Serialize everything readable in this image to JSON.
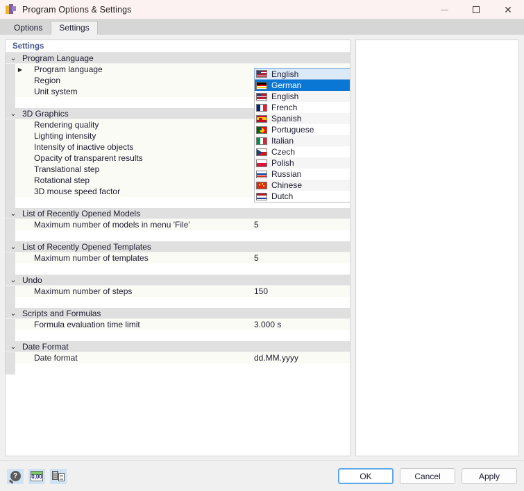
{
  "window": {
    "title": "Program Options & Settings",
    "icon": "app-logo-icon",
    "controls": {
      "minimize": "minimize-icon",
      "maximize": "maximize-icon",
      "close": "close-icon"
    }
  },
  "tabs": [
    {
      "label": "Options",
      "active": false
    },
    {
      "label": "Settings",
      "active": true
    }
  ],
  "grid": {
    "header": "Settings",
    "groups": [
      {
        "title": "Program Language",
        "expanded": true,
        "items": [
          {
            "label": "Program language",
            "value": "",
            "has_twisty": true
          },
          {
            "label": "Region",
            "value": ""
          },
          {
            "label": "Unit system",
            "value": ""
          }
        ]
      },
      {
        "title": "3D Graphics",
        "expanded": true,
        "items": [
          {
            "label": "Rendering quality",
            "value": ""
          },
          {
            "label": "Lighting intensity",
            "value": ""
          },
          {
            "label": "Intensity of inactive objects",
            "value": ""
          },
          {
            "label": "Opacity of transparent results",
            "value": ""
          },
          {
            "label": "Translational step",
            "value": ""
          },
          {
            "label": "Rotational step",
            "value": ""
          },
          {
            "label": "3D mouse speed factor",
            "value": ""
          }
        ]
      },
      {
        "title": "List of Recently Opened Models",
        "expanded": true,
        "items": [
          {
            "label": "Maximum number of models in menu 'File'",
            "value": "5"
          }
        ]
      },
      {
        "title": "List of Recently Opened Templates",
        "expanded": true,
        "items": [
          {
            "label": "Maximum number of templates",
            "value": "5"
          }
        ]
      },
      {
        "title": "Undo",
        "expanded": true,
        "items": [
          {
            "label": "Maximum number of steps",
            "value": "150"
          }
        ]
      },
      {
        "title": "Scripts and Formulas",
        "expanded": true,
        "items": [
          {
            "label": "Formula evaluation time limit",
            "value": "3.000 s"
          }
        ]
      },
      {
        "title": "Date Format",
        "expanded": true,
        "items": [
          {
            "label": "Date format",
            "value": "dd.MM.yyyy"
          }
        ]
      }
    ]
  },
  "language_combo": {
    "selected_display": "English",
    "selected_display_flag": "flag-us",
    "highlighted": "German",
    "chevron": "chevron-down-icon",
    "options": [
      {
        "label": "German",
        "flag": "flag-de",
        "selected": true
      },
      {
        "label": "English",
        "flag": "flag-us",
        "selected": false
      },
      {
        "label": "French",
        "flag": "flag-fr",
        "selected": false
      },
      {
        "label": "Spanish",
        "flag": "flag-es",
        "selected": false
      },
      {
        "label": "Portuguese",
        "flag": "flag-pt",
        "selected": false
      },
      {
        "label": "Italian",
        "flag": "flag-it",
        "selected": false
      },
      {
        "label": "Czech",
        "flag": "flag-cz",
        "selected": false
      },
      {
        "label": "Polish",
        "flag": "flag-pl",
        "selected": false
      },
      {
        "label": "Russian",
        "flag": "flag-ru",
        "selected": false
      },
      {
        "label": "Chinese",
        "flag": "flag-cn",
        "selected": false
      },
      {
        "label": "Dutch",
        "flag": "flag-nl",
        "selected": false
      }
    ]
  },
  "footer": {
    "icons": [
      {
        "name": "help-search-icon",
        "glyph": "?"
      },
      {
        "name": "decimal-places-icon",
        "glyph": "0,00"
      },
      {
        "name": "export-settings-icon",
        "glyph": ""
      }
    ],
    "buttons": [
      {
        "label": "OK",
        "default": true
      },
      {
        "label": "Cancel",
        "default": false
      },
      {
        "label": "Apply",
        "default": false
      }
    ]
  },
  "colors": {
    "titlebar": "#fdf2f2",
    "accent_selected": "#0a77d5",
    "group_header": "#e0e0e0",
    "grid_header_text": "#44558c",
    "combo_field": "#dbeaf9",
    "footer_icon_bg": "#cfe3f5",
    "default_button_border": "#5ea7e8"
  }
}
